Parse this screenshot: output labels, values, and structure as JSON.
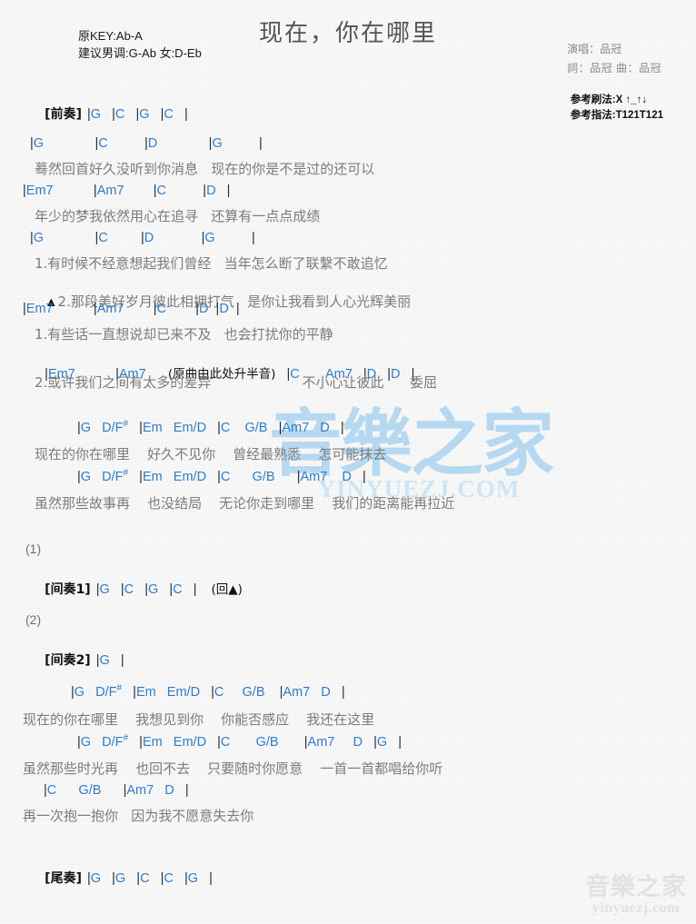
{
  "document": {
    "title": "现在，你在哪里",
    "key_info": {
      "original_key": "原KEY:Ab-A",
      "suggested_key": "建议男调:G-Ab 女:D-Eb"
    },
    "credits": {
      "singer": "演唱：品冠",
      "writers": "詞：品冠  曲：品冠"
    },
    "play_info": {
      "strum": "参考刷法:X ↑_↑↓",
      "fingerstyle": "参考指法:T121T121"
    }
  },
  "colors": {
    "chord": "#2f7cc4",
    "lyric": "#7b7b7b",
    "bar": "#2b2b2b",
    "title": "#555555",
    "watermark": "#8fc7ee",
    "background": "#f2f2f2"
  },
  "sections": {
    "intro": {
      "label": "[前奏]",
      "chords": "|G   |C   |G   |C   |"
    },
    "verse1": {
      "line1_chords": "|G              |C          |D              |G          |",
      "line1_lyrics": "蓦然回首好久没听到你消息   现在的你是不是过的还可以",
      "line2_chords": "|Em7           |Am7        |C          |D   |",
      "line2_lyrics": "年少的梦我依然用心在追寻   还算有一点点成绩",
      "line3_chords": "|G              |C         |D             |G          |",
      "line3_lyrics_a": "1.有时候不经意想起我们曾经   当年怎么断了联繫不敢追忆",
      "line3_lyrics_b_marker": "▲",
      "line3_lyrics_b": "2.那段美好岁月彼此相拥打气   是你让我看到人心光辉美丽",
      "line4_chords": "|Em7           |Am7        |C        |D  |D  |",
      "line4_lyrics": "1.有些话一直想说却已来不及   也会打扰你的平静",
      "line5_chords_a": "|Em7           |Am7      ",
      "line5_note": "(原曲由此处升半音)",
      "line5_chords_b": "   |C       Am7   |D   |D   |",
      "line5_lyrics": "2.或许我们之间有太多的差异                     不小心让彼此      委屈"
    },
    "chorus1": {
      "line1_chords": "|G   D/F#   |Em   Em/D   |C    G/B   |Am7   D   |",
      "line1_lyrics": "现在的你在哪里    好久不见你    曾经最熟悉    怎可能抹去",
      "line2_chords": "|G   D/F#   |Em   Em/D   |C      G/B      |Am7    D   |",
      "line2_lyrics": "虽然那些故事再    也没结局    无论你走到哪里    我们的距离能再拉近"
    },
    "interlude1": {
      "number": "(1)",
      "label": "[间奏1]",
      "chords": "|G   |C   |G   |C   |",
      "repeat_note": "(回▲)"
    },
    "interlude2": {
      "number": "(2)",
      "label": "[间奏2]",
      "chords": "|G   |"
    },
    "chorus2": {
      "line1_chords": "|G   D/F#   |Em   Em/D   |C     G/B    |Am7   D   |",
      "line1_lyrics": "现在的你在哪里    我想见到你    你能否感应    我还在这里",
      "line2_chords": "|G   D/F#   |Em   Em/D   |C       G/B       |Am7     D   |G   |",
      "line2_lyrics": "虽然那些时光再    也回不去    只要随时你愿意    一首一首都唱给你听",
      "line3_chords": "|C      G/B      |Am7   D   |",
      "line3_lyrics": "再一次抱一抱你   因为我不愿意失去你"
    },
    "outro": {
      "label": "[尾奏]",
      "chords": "|G   |G   |C   |C   |G   |"
    }
  },
  "watermarks": {
    "center_cn": "音樂之家",
    "center_url": "YINYUEZJ.COM",
    "corner_cn": "音樂之家",
    "corner_url": "yinyuezj.com"
  }
}
